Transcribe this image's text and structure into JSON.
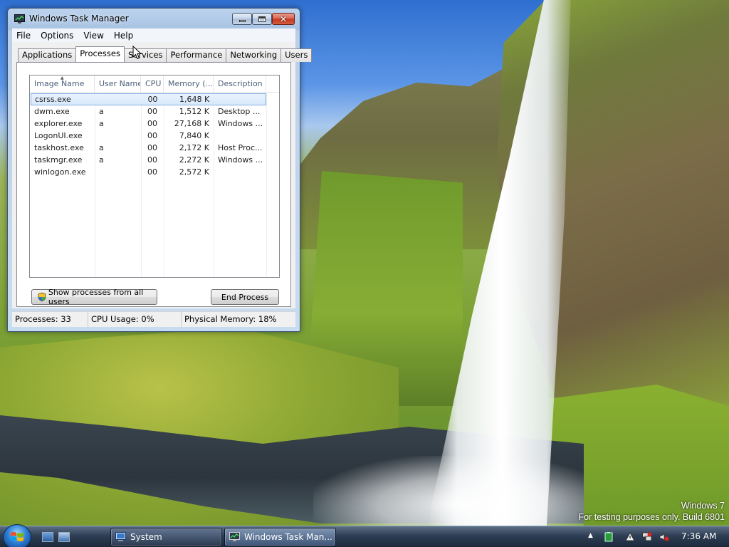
{
  "window": {
    "title": "Windows Task Manager",
    "menu": [
      "File",
      "Options",
      "View",
      "Help"
    ],
    "tabs": [
      "Applications",
      "Processes",
      "Services",
      "Performance",
      "Networking",
      "Users"
    ],
    "active_tab": "Processes"
  },
  "process_table": {
    "columns": [
      "Image Name",
      "User Name",
      "CPU",
      "Memory (...",
      "Description"
    ],
    "rows": [
      {
        "image": "csrss.exe",
        "user": "",
        "cpu": "00",
        "memory": "1,648 K",
        "description": ""
      },
      {
        "image": "dwm.exe",
        "user": "a",
        "cpu": "00",
        "memory": "1,512 K",
        "description": "Desktop ..."
      },
      {
        "image": "explorer.exe",
        "user": "a",
        "cpu": "00",
        "memory": "27,168 K",
        "description": "Windows ..."
      },
      {
        "image": "LogonUI.exe",
        "user": "",
        "cpu": "00",
        "memory": "7,840 K",
        "description": ""
      },
      {
        "image": "taskhost.exe",
        "user": "a",
        "cpu": "00",
        "memory": "2,172 K",
        "description": "Host Proc..."
      },
      {
        "image": "taskmgr.exe",
        "user": "a",
        "cpu": "00",
        "memory": "2,272 K",
        "description": "Windows ..."
      },
      {
        "image": "winlogon.exe",
        "user": "",
        "cpu": "00",
        "memory": "2,572 K",
        "description": ""
      }
    ],
    "selected_row": "csrss.exe"
  },
  "buttons": {
    "show_all": "Show processes from all users",
    "end_process": "End Process"
  },
  "status": {
    "processes": "Processes: 33",
    "cpu": "CPU Usage: 0%",
    "memory": "Physical Memory: 18%"
  },
  "desktop": {
    "watermark_line1": "Windows  7",
    "watermark_line2": "For testing purposes only. Build 6801"
  },
  "taskbar": {
    "tasks": [
      "System",
      "Windows Task Man..."
    ],
    "active_task": "Windows Task Man...",
    "clock": "7:36 AM"
  },
  "icons": {
    "app": "task-manager-icon",
    "start": "windows-start-orb",
    "quick_launch": [
      "show-desktop-icon",
      "switch-windows-icon"
    ],
    "tray": [
      "tray-chevron-icon",
      "battery-icon",
      "action-center-icon",
      "network-icon",
      "volume-muted-icon"
    ]
  },
  "colors": {
    "title_glass": "#a7c2e3",
    "selection": "#d6e8fc",
    "close_button": "#c4361f",
    "taskbar": "#2e3e54"
  }
}
